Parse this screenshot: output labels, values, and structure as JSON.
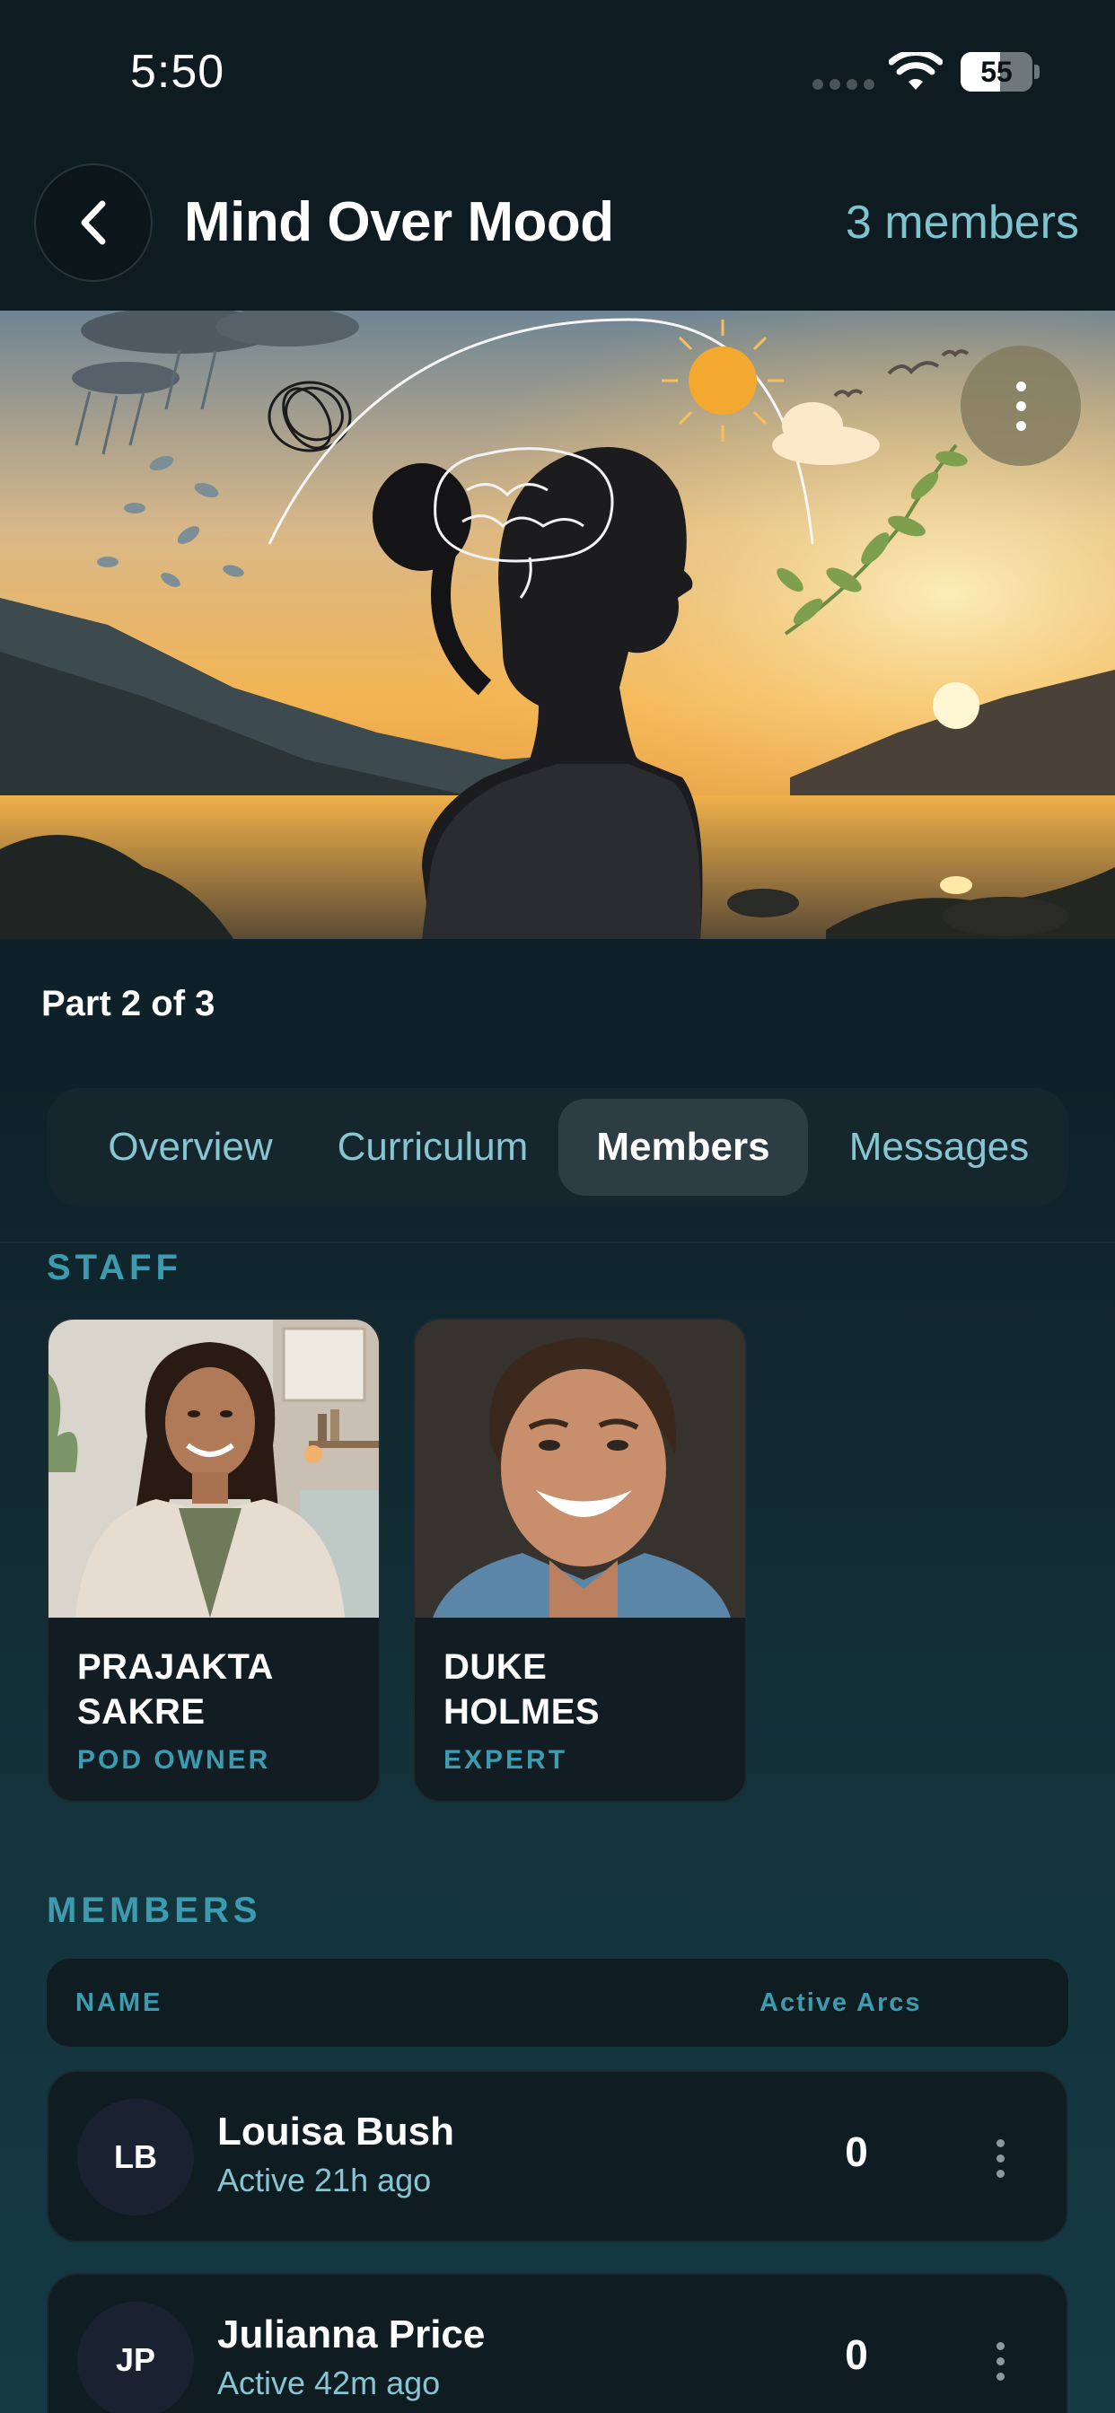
{
  "status_bar": {
    "time": "5:50",
    "battery_level": "55",
    "battery_fraction": 0.55,
    "icons": [
      "signal-dots-icon",
      "wifi-icon",
      "battery-icon"
    ]
  },
  "header": {
    "title": "Mind Over Mood",
    "member_count": "3 members",
    "back_icon": "chevron-left-icon"
  },
  "hero": {
    "more_icon": "vertical-dots-icon"
  },
  "progress": {
    "label": "Part 2 of 3"
  },
  "tabs": {
    "items": [
      {
        "label": "Overview",
        "active": false
      },
      {
        "label": "Curriculum",
        "active": false
      },
      {
        "label": "Members",
        "active": true
      },
      {
        "label": "Messages",
        "active": false
      }
    ]
  },
  "staff": {
    "title": "STAFF",
    "cards": [
      {
        "first": "PRAJAKTA",
        "last": "SAKRE",
        "role": "POD OWNER"
      },
      {
        "first": "DUKE",
        "last": "HOLMES",
        "role": "EXPERT"
      }
    ]
  },
  "members": {
    "title": "MEMBERS",
    "columns": {
      "name": "NAME",
      "arcs": "Active Arcs"
    },
    "rows": [
      {
        "initials": "LB",
        "name": "Louisa Bush",
        "status": "Active 21h ago",
        "arcs": "0"
      },
      {
        "initials": "JP",
        "name": "Julianna Price",
        "status": "Active 42m ago",
        "arcs": "0"
      }
    ]
  },
  "colors": {
    "accent": "#3d9bb0",
    "link": "#7fc3cf",
    "background": "#0f1f26",
    "card": "#0f1d22"
  }
}
